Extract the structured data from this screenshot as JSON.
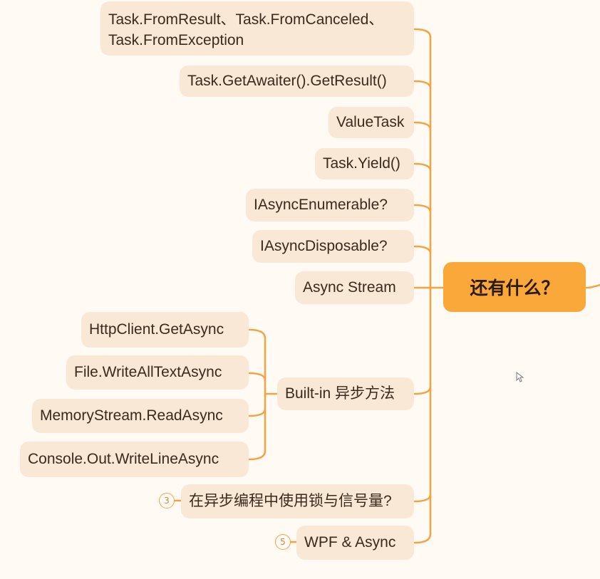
{
  "center_topic": "还有什么？",
  "branches": [
    {
      "label": "Task.FromResult、Task.FromCanceled、Task.FromException"
    },
    {
      "label": "Task.GetAwaiter().GetResult()"
    },
    {
      "label": "ValueTask"
    },
    {
      "label": "Task.Yield()"
    },
    {
      "label": "IAsyncEnumerable?"
    },
    {
      "label": "IAsyncDisposable?"
    },
    {
      "label": "Async Stream"
    },
    {
      "label": "Built-in 异步方法",
      "children": [
        {
          "label": "HttpClient.GetAsync"
        },
        {
          "label": "File.WriteAllTextAsync"
        },
        {
          "label": "MemoryStream.ReadAsync"
        },
        {
          "label": "Console.Out.WriteLineAsync"
        }
      ]
    },
    {
      "label": "在异步编程中使用锁与信号量?",
      "collapsed_count": "3"
    },
    {
      "label": "WPF & Async",
      "collapsed_count": "5"
    }
  ],
  "colors": {
    "background": "#fffbf4",
    "node_fill": "#f9e8d6",
    "center_fill": "#fba83b",
    "connector": "#f4a340"
  }
}
